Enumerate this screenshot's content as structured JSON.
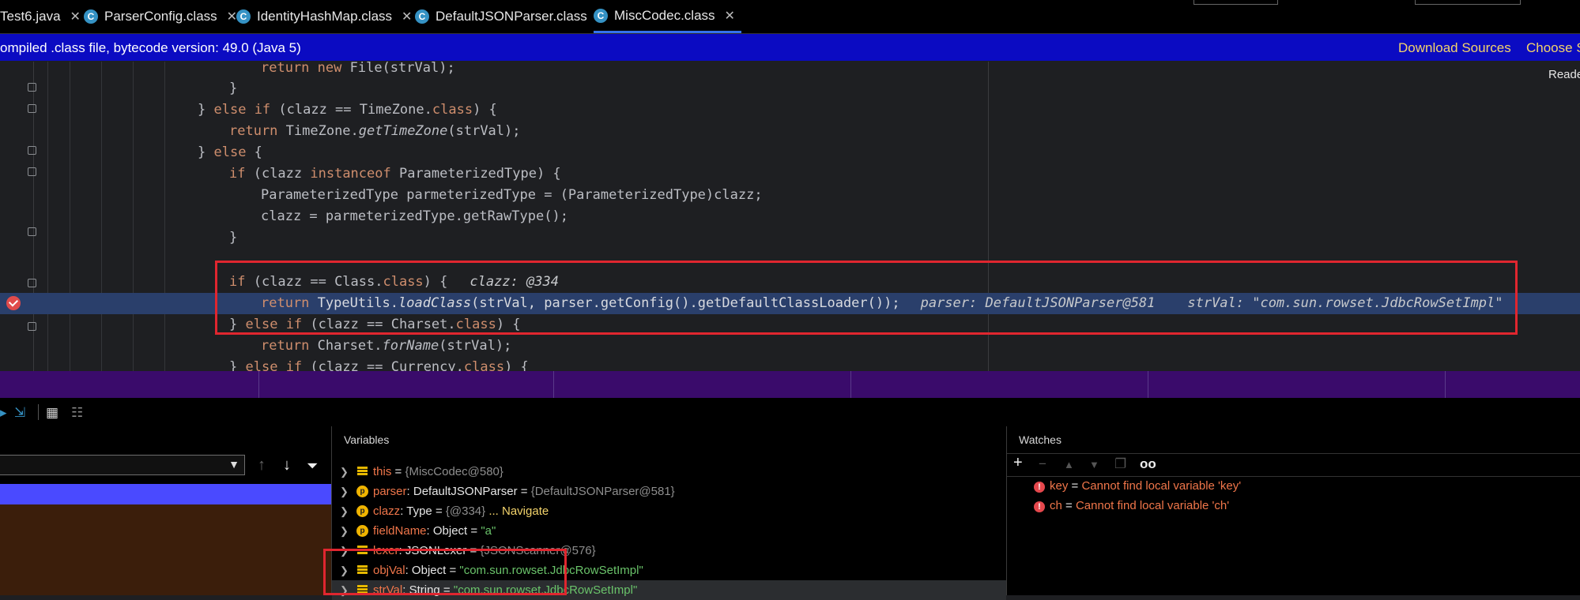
{
  "tabs": [
    {
      "label": "Test6.java",
      "icon": "java-file-icon"
    },
    {
      "label": "ParserConfig.class",
      "icon": "class-file-icon"
    },
    {
      "label": "IdentityHashMap.class",
      "icon": "class-file-icon"
    },
    {
      "label": "DefaultJSONParser.class",
      "icon": "class-file-icon"
    },
    {
      "label": "MiscCodec.class",
      "icon": "class-file-icon",
      "active": true
    }
  ],
  "banner": {
    "message": "ompiled .class file, bytecode version: 49.0 (Java 5)",
    "download_sources": "Download Sources",
    "choose_sources": "Choose S"
  },
  "reader_mode": "Reade",
  "code": {
    "l1": "return new File(strVal);",
    "l2": "}",
    "l3_a": "} else if (clazz == TimeZone.class) {",
    "l4": "return TimeZone.getTimeZone(strVal);",
    "l5": "} else {",
    "l6": "if (clazz instanceof ParameterizedType) {",
    "l7": "ParameterizedType parmeterizedType = (ParameterizedType)clazz;",
    "l8": "clazz = parmeterizedType.getRawType();",
    "l9": "}",
    "l11": "if (clazz == Class.class) {",
    "l11_hint": "clazz: @334",
    "l12": "return TypeUtils.loadClass(strVal, parser.getConfig().getDefaultClassLoader());",
    "l12_hint": "parser: DefaultJSONParser@581    strVal: \"com.sun.rowset.JdbcRowSetImpl\"",
    "l13": "} else if (clazz == Charset.class) {",
    "l14": "return Charset.forName(strVal);",
    "l15": "} else if (clazz == Currency.class) {"
  },
  "variables": {
    "title": "Variables",
    "rows": [
      {
        "name": "this",
        "type": "",
        "eq": " = ",
        "value": "{MiscCodec@580}",
        "kind": "field",
        "vclass": "ref"
      },
      {
        "name": "parser",
        "type": ": DefaultJSONParser",
        "eq": " = ",
        "value": "{DefaultJSONParser@581}",
        "kind": "param",
        "vclass": "ref"
      },
      {
        "name": "clazz",
        "type": ": Type",
        "eq": " = ",
        "value": "{@334}",
        "extra": " ... Navigate",
        "kind": "param",
        "vclass": "ref"
      },
      {
        "name": "fieldName",
        "type": ": Object",
        "eq": " = ",
        "value": "\"a\"",
        "kind": "param",
        "vclass": "str"
      },
      {
        "name": "lexer",
        "type": ": JSONLexer",
        "eq": " = ",
        "value": "{JSONScanner@576}",
        "kind": "field",
        "vclass": "ref"
      },
      {
        "name": "objVal",
        "type": ": Object",
        "eq": " = ",
        "value": "\"com.sun.rowset.JdbcRowSetImpl\"",
        "kind": "field",
        "vclass": "str"
      },
      {
        "name": "strVal",
        "type": ": String",
        "eq": " = ",
        "value": "\"com.sun.rowset.JdbcRowSetImpl\"",
        "kind": "field",
        "vclass": "str",
        "selected": true
      }
    ]
  },
  "watches": {
    "title": "Watches",
    "rows": [
      {
        "name": "key",
        "eq": " = ",
        "message": "Cannot find local variable 'key'"
      },
      {
        "name": "ch",
        "eq": " = ",
        "message": "Cannot find local variable 'ch'"
      }
    ]
  },
  "colors": {
    "banner_bg": "#0b0bc2",
    "exec_line": "#2a3f6b",
    "highlight_box": "#e0262f",
    "keyword": "#cf8e6d",
    "string_value": "#6ac36a"
  }
}
